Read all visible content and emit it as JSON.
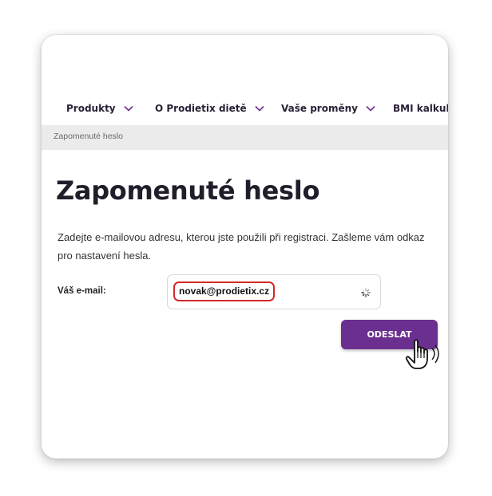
{
  "nav": {
    "items": [
      {
        "label": "Produkty"
      },
      {
        "label": "O Prodietix dietě"
      },
      {
        "label": "Vaše proměny"
      },
      {
        "label": "BMI kalkulač"
      }
    ]
  },
  "breadcrumb": "Zapomenuté heslo",
  "page": {
    "title": "Zapomenuté heslo",
    "description": "Zadejte e-mailovou adresu, kterou jste použili při registraci. Zašleme vám odkaz pro nastavení hesla."
  },
  "form": {
    "email_label": "Váš e-mail:",
    "email_value": "novak@prodietix.cz",
    "submit_label": "ODESLAT"
  },
  "colors": {
    "accent": "#6b2f8f",
    "highlight": "#d32a2a",
    "breadcrumb_bg": "#ebebeb"
  },
  "icons": {
    "nav_chevron": "chevron-down-icon",
    "loading": "spinner-icon",
    "cursor": "hand-pointer-icon"
  }
}
